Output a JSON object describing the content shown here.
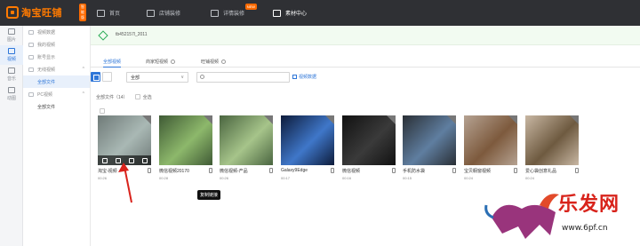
{
  "header": {
    "logo_text": "淘宝旺铺",
    "logo_badge": "智能版",
    "nav": [
      {
        "label": "首页",
        "badge": ""
      },
      {
        "label": "店铺装修",
        "badge": ""
      },
      {
        "label": "详情装修",
        "badge": "NEW"
      },
      {
        "label": "素材中心",
        "badge": ""
      }
    ]
  },
  "rail": [
    {
      "label": "图片",
      "icon": "image-icon"
    },
    {
      "label": "视频",
      "icon": "video-icon",
      "active": true
    },
    {
      "label": "音乐",
      "icon": "music-icon"
    },
    {
      "label": "动图",
      "icon": "gif-icon"
    }
  ],
  "sidebar": {
    "items": [
      {
        "label": "视频数据"
      },
      {
        "label": "我的视频"
      },
      {
        "label": "账号显示"
      },
      {
        "label": "无线视频",
        "caret": "^"
      },
      {
        "label": "全部文件",
        "sub": true,
        "active": true
      },
      {
        "label": "PC视频",
        "caret": "^"
      },
      {
        "label": "全部文件",
        "sub": true
      }
    ]
  },
  "store": {
    "name": "tb452157l_2011"
  },
  "tabs": [
    {
      "label": "全部视频",
      "active": true
    },
    {
      "label": "商家短视频",
      "info": true
    },
    {
      "label": "旺铺视频",
      "info": true
    }
  ],
  "toolbar": {
    "filter_value": "全部",
    "filter_chevron": "∨",
    "search_placeholder": "",
    "add_label": "视频数据"
  },
  "list": {
    "count_label": "全部文件（14）",
    "select_all_label": "全选"
  },
  "videos": [
    {
      "title": "淘宝-视频",
      "duration": "00:26",
      "thumb": "#6f7a78",
      "accent": "#a9b8b4",
      "overlay": true
    },
    {
      "title": "微信视频20170",
      "duration": "00:28",
      "thumb": "#3f5a35",
      "accent": "#8db86b",
      "overlay": false
    },
    {
      "title": "微信视频-产品",
      "duration": "00:26",
      "thumb": "#4a6540",
      "accent": "#a6c48a",
      "overlay": false
    },
    {
      "title": "Galaxy9Edge",
      "duration": "00:17",
      "thumb": "#0d1b3a",
      "accent": "#3f77c9",
      "overlay": false
    },
    {
      "title": "微信视频",
      "duration": "00:16",
      "thumb": "#111111",
      "accent": "#3a3a3a",
      "overlay": false
    },
    {
      "title": "手机防水袋",
      "duration": "00:15",
      "thumb": "#2a2f35",
      "accent": "#5f7ea0",
      "overlay": false
    },
    {
      "title": "宝贝橱窗视频",
      "duration": "00:24",
      "thumb": "#b5a292",
      "accent": "#7d5a3d",
      "overlay": false
    },
    {
      "title": "爱心袋创意礼品",
      "duration": "00:24",
      "thumb": "#c8b7a3",
      "accent": "#6e5a40",
      "overlay": false
    }
  ],
  "tooltip": "复制链接",
  "watermark": {
    "brand": "乐发网",
    "url": "www.6pf.cn"
  },
  "colors": {
    "accent": "#2e76d8",
    "brand_orange": "#ff7a00",
    "arrow": "#d9231c"
  }
}
